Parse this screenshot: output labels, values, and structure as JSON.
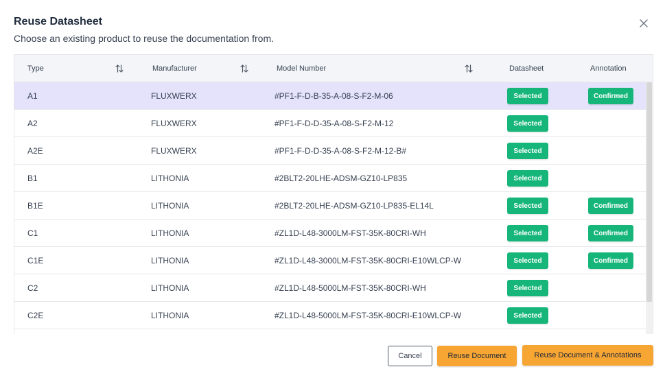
{
  "modal": {
    "title": "Reuse Datasheet",
    "subtitle": "Choose an existing product to reuse the documentation from."
  },
  "table": {
    "headers": {
      "type": "Type",
      "manufacturer": "Manufacturer",
      "model_number": "Model Number",
      "datasheet": "Datasheet",
      "annotation": "Annotation"
    },
    "rows": [
      {
        "type": "A1",
        "manufacturer": "FLUXWERX",
        "model": "#PF1-F-D-B-35-A-08-S-F2-M-06",
        "datasheet": "Selected",
        "annotation": "Confirmed",
        "selected": true
      },
      {
        "type": "A2",
        "manufacturer": "FLUXWERX",
        "model": "#PF1-F-D-D-35-A-08-S-F2-M-12",
        "datasheet": "Selected",
        "annotation": ""
      },
      {
        "type": "A2E",
        "manufacturer": "FLUXWERX",
        "model": "#PF1-F-D-D-35-A-08-S-F2-M-12-B#",
        "datasheet": "Selected",
        "annotation": ""
      },
      {
        "type": "B1",
        "manufacturer": "LITHONIA",
        "model": "#2BLT2-20LHE-ADSM-GZ10-LP835",
        "datasheet": "Selected",
        "annotation": ""
      },
      {
        "type": "B1E",
        "manufacturer": "LITHONIA",
        "model": "#2BLT2-20LHE-ADSM-GZ10-LP835-EL14L",
        "datasheet": "Selected",
        "annotation": "Confirmed"
      },
      {
        "type": "C1",
        "manufacturer": "LITHONIA",
        "model": "#ZL1D-L48-3000LM-FST-35K-80CRI-WH",
        "datasheet": "Selected",
        "annotation": "Confirmed"
      },
      {
        "type": "C1E",
        "manufacturer": "LITHONIA",
        "model": "#ZL1D-L48-3000LM-FST-35K-80CRI-E10WLCP-W",
        "datasheet": "Selected",
        "annotation": "Confirmed"
      },
      {
        "type": "C2",
        "manufacturer": "LITHONIA",
        "model": "#ZL1D-L48-5000LM-FST-35K-80CRI-WH",
        "datasheet": "Selected",
        "annotation": ""
      },
      {
        "type": "C2E",
        "manufacturer": "LITHONIA",
        "model": "#ZL1D-L48-5000LM-FST-35K-80CRI-E10WLCP-W",
        "datasheet": "Selected",
        "annotation": ""
      }
    ]
  },
  "footer": {
    "cancel_label": "Cancel",
    "reuse_label": "Reuse Document",
    "reuse_ann_label": "Reuse Document & Annotations"
  },
  "colors": {
    "badge_green": "#16b67a",
    "selected_row": "#e4e3fb",
    "primary_orange": "#f7a533",
    "header_bg": "#f3f5f8"
  },
  "icons": {
    "close": "close-icon",
    "sort": "sort-icon"
  }
}
